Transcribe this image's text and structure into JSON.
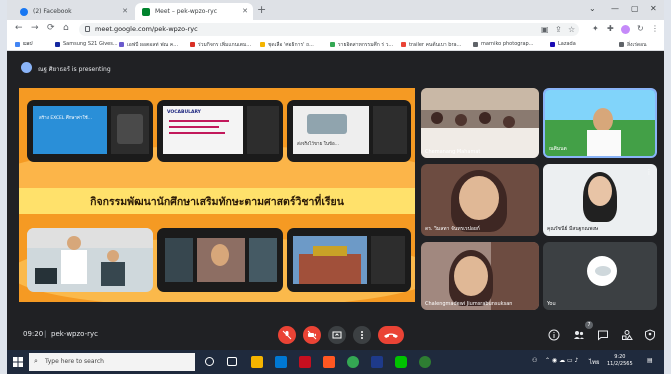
{
  "browser": {
    "tabs": [
      {
        "label": "(2) Facebook",
        "favicon_color": "#1877f2",
        "active": false
      },
      {
        "label": "Meet – pek-wpzo-ryc",
        "favicon_color": "#00832d",
        "active": true
      }
    ],
    "new_tab_label": "+",
    "url": "meet.google.com/pek-wpzo-ryc",
    "window_controls": [
      "⌄",
      "—",
      "▢",
      "✕"
    ]
  },
  "bookmarks": [
    {
      "label": "ແອປ",
      "color": "#4285f4"
    },
    {
      "label": "Samsung S21 Gives...",
      "color": "#1428a0"
    },
    {
      "label": "เอฟบี ผอตอลท่ ฟณ ค...",
      "color": "#6a5acd"
    },
    {
      "label": "ร่วมกิจกร เพิ่มแกนเตม...",
      "color": "#d93025"
    },
    {
      "label": "ชุดเลือ 'ศอธิการ' ถ...",
      "color": "#f4b400"
    },
    {
      "label": "รายอิตสาหกรรมศึก ร่ ว...",
      "color": "#34a853"
    },
    {
      "label": "trailer คนต้นเบา bra...",
      "color": "#ea4335"
    },
    {
      "label": "marniko photograp...",
      "color": "#5f6368"
    },
    {
      "label": "Lazada",
      "color": "#1a0bb4"
    },
    {
      "label": "สิ่งเร่ดอน",
      "color": "#5f6368"
    }
  ],
  "presenter_banner": "ณฐ ศิยาธอร้ is presenting",
  "slide": {
    "title": "กิจกรรมพัฒนานักศึกษาเสริมทักษะตามศาสตร์วิชาที่เรียน",
    "captions": [
      "สร้าง EXCEL ศึกษาค่าใช้...",
      "VOCABULARY",
      "ส่งจริงไว้ขาย ในข้อ..."
    ]
  },
  "participants": [
    {
      "name": "Chemanang Mahamat"
    },
    {
      "name": "ณศิมนต"
    },
    {
      "name": "ดร. วิมลทา จันทรเรปอยก์"
    },
    {
      "name": "คุณรัชนีย์ มีสนฐกณพงษ"
    },
    {
      "name": "Chalengmadewi Jiumsrabunsuksan"
    },
    {
      "name": "You"
    }
  ],
  "bottom_bar": {
    "time": "09:20",
    "separator": "|",
    "meeting_code": "pek-wpzo-ryc",
    "participant_count": "7"
  },
  "taskbar": {
    "search_placeholder": "Type here to search",
    "clock_time": "9:20",
    "clock_date": "11/2/2565",
    "language": "ไทย"
  },
  "colors": {
    "meet_bg": "#202124",
    "end_call": "#ea4335",
    "slide_orange": "#f59a23",
    "slide_band": "#ffe16b"
  }
}
